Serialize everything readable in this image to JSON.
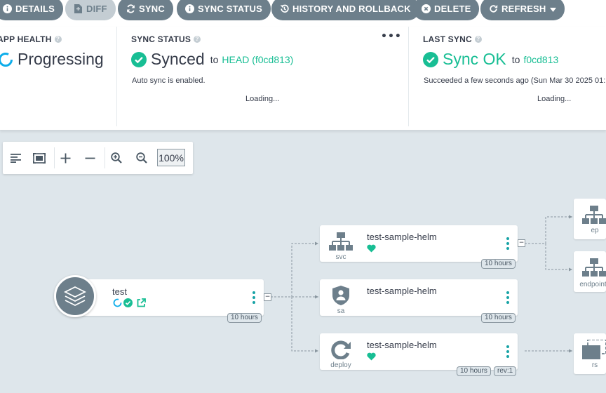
{
  "toolbar": {
    "details": "DETAILS",
    "diff": "DIFF",
    "sync": "SYNC",
    "sync_status": "SYNC STATUS",
    "history": "HISTORY AND ROLLBACK",
    "delete": "DELETE",
    "refresh": "REFRESH"
  },
  "app_health": {
    "title": "APP HEALTH",
    "status": "Progressing",
    "loading": ""
  },
  "sync_status": {
    "title": "SYNC STATUS",
    "status": "Synced",
    "to": "to",
    "revision": "HEAD (f0cd813)",
    "note": "Auto sync is enabled.",
    "loading": "Loading...",
    "menu": "•••"
  },
  "last_sync": {
    "title": "LAST SYNC",
    "status": "Sync OK",
    "to": "to",
    "revision": "f0cd813",
    "note": "Succeeded a few seconds ago (Sun Mar 30 2025 01:",
    "loading": "Loading..."
  },
  "graph_tools": {
    "zoom": "100%"
  },
  "graph": {
    "root": {
      "name": "test",
      "age": "10 hours"
    },
    "nodes": [
      {
        "name": "test-sample-helm",
        "kind": "svc",
        "age": "10 hours",
        "rev": ""
      },
      {
        "name": "test-sample-helm",
        "kind": "sa",
        "age": "10 hours",
        "rev": ""
      },
      {
        "name": "test-sample-helm",
        "kind": "deploy",
        "age": "10 hours",
        "rev": "rev:1"
      }
    ],
    "children": [
      {
        "kind": "ep"
      },
      {
        "kind": "endpoints"
      },
      {
        "kind": "rs"
      }
    ]
  },
  "colors": {
    "synced": "#18be94",
    "progressing": "#0dadea",
    "button": "#6d7f8b",
    "background": "#dee6eb"
  }
}
